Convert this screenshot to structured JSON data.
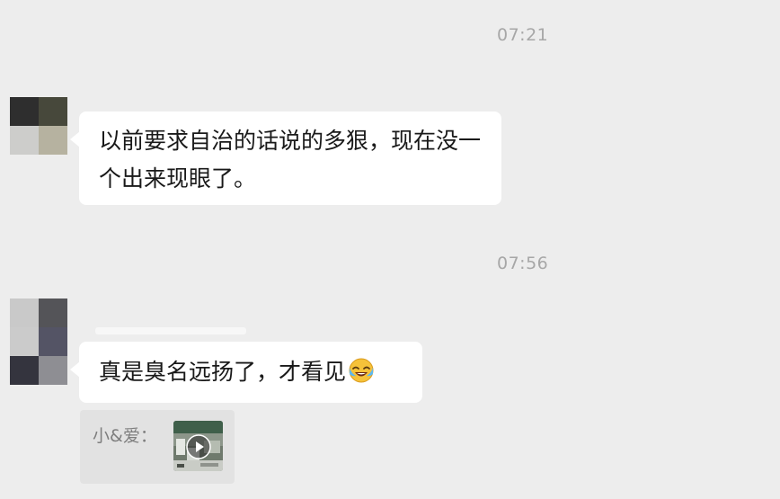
{
  "chat": {
    "messages": [
      {
        "timestamp": "07:21",
        "text": "以前要求自治的话说的多狠，现在没一个出来现眼了。"
      },
      {
        "timestamp": "07:56",
        "text": "真是臭名远扬了，才看见"
      }
    ],
    "quote": {
      "sender": "小&爱："
    }
  },
  "colors": {
    "background": "#ededed",
    "bubble": "#ffffff",
    "timestamp_text": "#a7a7a7",
    "quote_background": "#e2e2e2"
  },
  "icons": {
    "reaction_emoji": "grinning-tears-emoji-icon",
    "video_play": "play-icon"
  }
}
